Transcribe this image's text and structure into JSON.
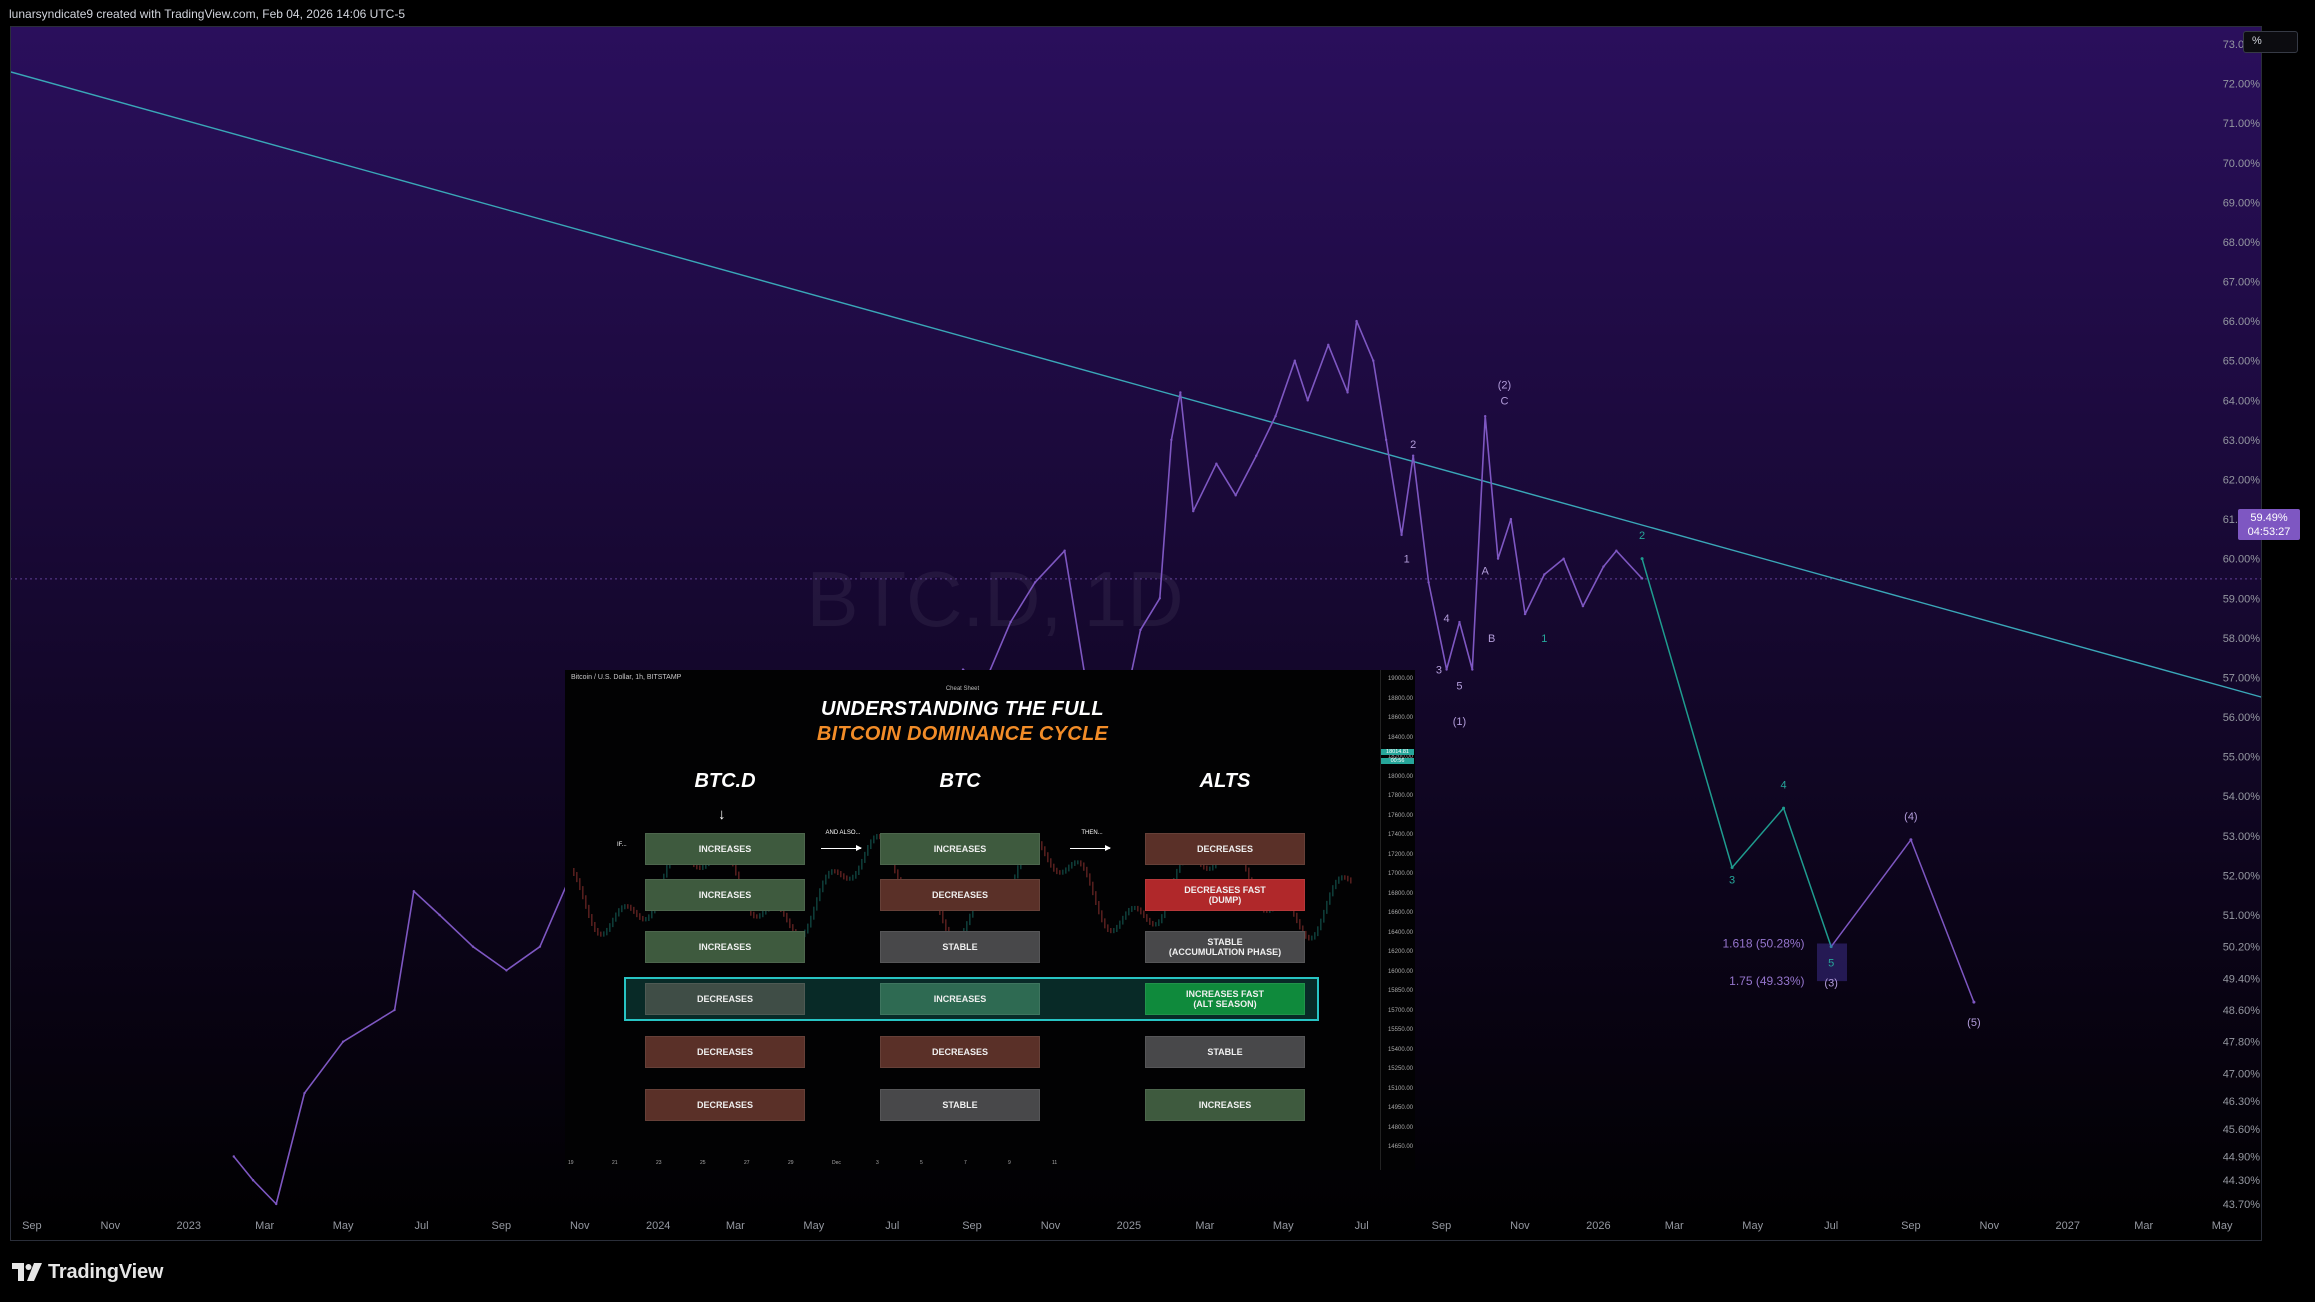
{
  "header": {
    "credit": "lunarsyndicate9 created with TradingView.com, Feb 04, 2026 14:06 UTC-5"
  },
  "toolbar": {
    "scale_mode": "%"
  },
  "footer": {
    "logo_text": "TradingView"
  },
  "colors": {
    "background_top": "#2a0f5c",
    "background_bottom": "#000000",
    "series": "#7e57c2",
    "trendline": "#3aa7b8",
    "projection_teal": "#1f9c8f",
    "projection_purple": "#7e57c2",
    "price_label_bg": "#7e57c2",
    "highlight": "#27c4c4"
  },
  "chart_data": {
    "type": "line",
    "title": "",
    "watermark": "BTC.D, 1D",
    "xlabel": "",
    "ylabel": "",
    "y_unit": "%",
    "log_scale": false,
    "grid": false,
    "ylim": [
      43.7,
      73.0
    ],
    "xlim": [
      "2022-08-15",
      "2027-06-01"
    ],
    "y_ticks": [
      "73.00%",
      "72.00%",
      "71.00%",
      "70.00%",
      "69.00%",
      "68.00%",
      "67.00%",
      "66.00%",
      "65.00%",
      "64.00%",
      "63.00%",
      "62.00%",
      "61.00%",
      "60.00%",
      "59.00%",
      "58.00%",
      "57.00%",
      "56.00%",
      "55.00%",
      "54.00%",
      "53.00%",
      "52.00%",
      "51.00%",
      "50.20%",
      "49.40%",
      "48.60%",
      "47.80%",
      "47.00%",
      "46.30%",
      "45.60%",
      "44.90%",
      "44.30%",
      "43.70%"
    ],
    "x_ticks": [
      "Sep",
      "Nov",
      "2023",
      "Mar",
      "May",
      "Jul",
      "Sep",
      "Nov",
      "2024",
      "Mar",
      "May",
      "Jul",
      "Sep",
      "Nov",
      "2025",
      "Mar",
      "May",
      "Jul",
      "Sep",
      "Nov",
      "2026",
      "Mar",
      "May",
      "Jul",
      "Sep",
      "Nov",
      "2027",
      "Mar",
      "May"
    ],
    "current_price": {
      "value": "59.49%",
      "countdown": "04:53:27"
    },
    "series": [
      {
        "name": "BTC.D",
        "x": [
          "2023-02-05",
          "2023-02-20",
          "2023-03-10",
          "2023-04-01",
          "2023-05-01",
          "2023-06-10",
          "2023-06-25",
          "2023-07-15",
          "2023-08-10",
          "2023-09-05",
          "2023-10-01",
          "2023-10-25",
          "2023-11-15",
          "2023-12-10",
          "2024-01-05",
          "2024-01-25",
          "2024-02-10",
          "2024-03-05",
          "2024-03-20",
          "2024-04-10",
          "2024-04-25",
          "2024-05-15",
          "2024-06-05",
          "2024-06-25",
          "2024-07-15",
          "2024-08-05",
          "2024-08-25",
          "2024-09-10",
          "2024-10-01",
          "2024-10-20",
          "2024-11-12",
          "2024-11-28",
          "2024-12-08",
          "2024-12-20",
          "2025-01-10",
          "2025-01-25",
          "2025-02-03",
          "2025-02-10",
          "2025-02-20",
          "2025-03-10",
          "2025-03-25",
          "2025-04-10",
          "2025-04-25",
          "2025-05-10",
          "2025-05-20",
          "2025-06-05",
          "2025-06-20",
          "2025-06-27",
          "2025-07-10",
          "2025-07-20",
          "2025-08-01",
          "2025-08-10",
          "2025-08-22",
          "2025-09-05",
          "2025-09-15",
          "2025-09-25",
          "2025-10-05",
          "2025-10-15",
          "2025-10-25",
          "2025-11-05",
          "2025-11-20",
          "2025-12-05",
          "2025-12-20",
          "2026-01-05",
          "2026-01-15",
          "2026-02-04"
        ],
        "values": [
          44.9,
          44.3,
          43.7,
          46.5,
          47.8,
          48.6,
          51.6,
          51.0,
          50.2,
          49.6,
          50.2,
          52.0,
          54.2,
          52.4,
          53.2,
          51.0,
          51.8,
          51.0,
          52.0,
          53.6,
          55.2,
          54.4,
          55.0,
          53.8,
          54.8,
          55.8,
          57.2,
          56.8,
          58.4,
          59.4,
          60.2,
          57.0,
          56.4,
          55.0,
          58.2,
          59.0,
          63.0,
          64.2,
          61.2,
          62.4,
          61.6,
          62.6,
          63.6,
          65.0,
          64.0,
          65.4,
          64.2,
          66.0,
          65.0,
          63.0,
          60.6,
          62.6,
          59.4,
          57.2,
          58.4,
          57.2,
          63.6,
          60.0,
          61.0,
          58.6,
          59.6,
          60.0,
          58.8,
          59.8,
          60.2,
          59.5
        ]
      },
      {
        "name": "Wave projection",
        "x": [
          "2026-02-04",
          "2026-04-15",
          "2026-05-25",
          "2026-07-01",
          "2026-09-01",
          "2026-10-20"
        ],
        "values": [
          60.0,
          52.2,
          53.7,
          50.2,
          52.9,
          48.8
        ]
      }
    ],
    "trendline": {
      "x": [
        "2022-08-15",
        "2027-06-01"
      ],
      "values": [
        72.3,
        56.5
      ]
    },
    "annotations": {
      "waves": [
        {
          "label": "(1)",
          "x": "2025-09-15",
          "y": 55.8
        },
        {
          "label": "1",
          "x": "2025-08-05",
          "y": 59.9
        },
        {
          "label": "2",
          "x": "2025-08-10",
          "y": 62.8
        },
        {
          "label": "3",
          "x": "2025-08-30",
          "y": 57.1
        },
        {
          "label": "4",
          "x": "2025-09-05",
          "y": 58.4
        },
        {
          "label": "5",
          "x": "2025-09-15",
          "y": 56.7
        },
        {
          "label": "(2)",
          "x": "2025-10-20",
          "y": 64.3
        },
        {
          "label": "C",
          "x": "2025-10-20",
          "y": 63.9
        },
        {
          "label": "A",
          "x": "2025-10-05",
          "y": 59.6
        },
        {
          "label": "B",
          "x": "2025-10-10",
          "y": 57.9
        },
        {
          "label": "1",
          "x": "2025-11-20",
          "y": 57.9
        },
        {
          "label": "2",
          "x": "2026-02-04",
          "y": 60.5
        },
        {
          "label": "3",
          "x": "2026-04-15",
          "y": 51.8
        },
        {
          "label": "4",
          "x": "2026-05-25",
          "y": 54.2
        },
        {
          "label": "5",
          "x": "2026-07-01",
          "y": 49.7
        },
        {
          "label": "(3)",
          "x": "2026-07-01",
          "y": 49.2
        },
        {
          "label": "(4)",
          "x": "2026-09-01",
          "y": 53.4
        },
        {
          "label": "(5)",
          "x": "2026-10-20",
          "y": 48.2
        }
      ],
      "fib_levels": [
        {
          "label": "1.618 (50.28%)",
          "value": 50.28
        },
        {
          "label": "1.75 (49.33%)",
          "value": 49.33
        }
      ]
    }
  },
  "inset": {
    "header": "Bitcoin / U.S. Dollar, 1h, BITSTAMP",
    "cheat_sheet": "Cheat Sheet",
    "title_line1": "UNDERSTANDING THE FULL",
    "title_line2": "BITCOIN DOMINANCE CYCLE",
    "if_label": "IF...",
    "and_also": "AND ALSO...",
    "then": "THEN...",
    "columns": [
      "BTC.D",
      "BTC",
      "ALTS"
    ],
    "rows": [
      [
        "INCREASES",
        "INCREASES",
        "DECREASES"
      ],
      [
        "INCREASES",
        "DECREASES",
        "DECREASES FAST\n(DUMP)"
      ],
      [
        "INCREASES",
        "STABLE",
        "STABLE\n(ACCUMULATION PHASE)"
      ],
      [
        "DECREASES",
        "INCREASES",
        "INCREASES FAST\n(ALT SEASON)"
      ],
      [
        "DECREASES",
        "DECREASES",
        "STABLE"
      ],
      [
        "DECREASES",
        "STABLE",
        "INCREASES"
      ]
    ],
    "cell_colors": [
      [
        "#3e5a3e",
        "#3e5a3e",
        "#5a3028"
      ],
      [
        "#3e5a3e",
        "#5a3028",
        "#b0282a"
      ],
      [
        "#3e5a3e",
        "#48484a",
        "#48484a"
      ],
      [
        "#3f4d46",
        "#2e6a52",
        "#0f8a3c"
      ],
      [
        "#5a3028",
        "#5a3028",
        "#48484a"
      ],
      [
        "#5a3028",
        "#48484a",
        "#3e5a3e"
      ]
    ],
    "scale": [
      "19000.00",
      "18800.00",
      "18600.00",
      "18400.00",
      "18200.00",
      "18000.00",
      "17800.00",
      "17600.00",
      "17400.00",
      "17200.00",
      "17000.00",
      "16800.00",
      "16600.00",
      "16400.00",
      "16200.00",
      "16000.00",
      "15850.00",
      "15700.00",
      "15550.00",
      "15400.00",
      "15250.00",
      "15100.00",
      "14950.00",
      "14800.00",
      "14650.00"
    ],
    "price_tag": "18014.81",
    "price_tag2": "00:56",
    "time_ticks": [
      "19",
      "21",
      "23",
      "25",
      "27",
      "29",
      "Dec",
      "3",
      "5",
      "7",
      "9",
      "11"
    ]
  }
}
